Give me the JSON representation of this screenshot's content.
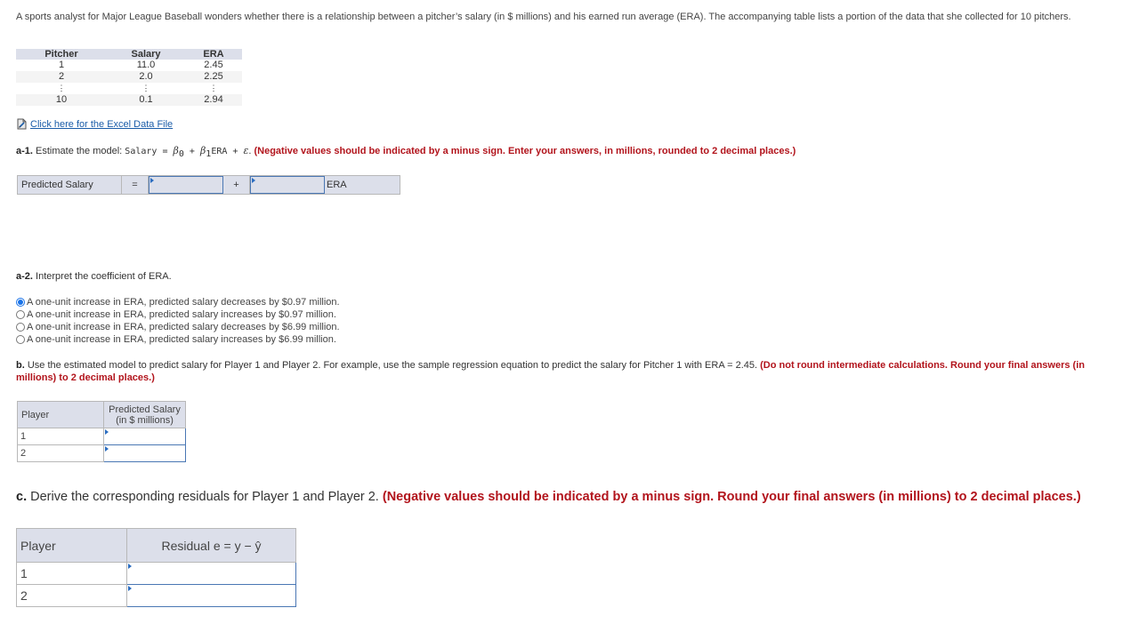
{
  "intro": "A sports analyst for Major League Baseball wonders whether there is a relationship between a pitcher’s salary (in $ millions) and his earned run average (ERA). The accompanying table lists a portion of the data that she collected for 10 pitchers.",
  "data_table": {
    "headers": [
      "Pitcher",
      "Salary",
      "ERA"
    ],
    "rows": [
      [
        "1",
        "11.0",
        "2.45"
      ],
      [
        "2",
        "2.0",
        "2.25"
      ],
      [
        "⋮",
        "⋮",
        "⋮"
      ],
      [
        "10",
        "0.1",
        "2.94"
      ]
    ]
  },
  "excel_link": {
    "icon": "excel-file-icon",
    "label": " Click here for the Excel Data File"
  },
  "a1": {
    "label": "a-1.",
    "text": " Estimate the model: ",
    "model_salary": "Salary",
    "model_eq": " = ",
    "beta0": "β",
    "beta0_sub": "0",
    "plus1": " + ",
    "beta1": "β",
    "beta1_sub": "1",
    "model_era": "ERA",
    "plus2": " + ",
    "epsilon": "ε",
    "period": ". ",
    "instruction": "(Negative values should be indicated by a minus sign. Enter your answers, in millions, rounded to 2 decimal places.)"
  },
  "equation": {
    "label": "Predicted Salary",
    "equals": "=",
    "intercept_value": "",
    "plus": "+",
    "slope_value": "",
    "tail": "ERA"
  },
  "a2": {
    "label": "a-2.",
    "text": " Interpret the coefficient of ERA.",
    "options": [
      {
        "label": "A one-unit increase in ERA, predicted salary decreases by $0.97 million.",
        "selected": true
      },
      {
        "label": "A one-unit increase in ERA, predicted salary increases by $0.97 million.",
        "selected": false
      },
      {
        "label": "A one-unit increase in ERA, predicted salary decreases by $6.99 million.",
        "selected": false
      },
      {
        "label": "A one-unit increase in ERA, predicted salary increases by $6.99 million.",
        "selected": false
      }
    ]
  },
  "b": {
    "label": "b.",
    "text": " Use the estimated model to predict salary for Player 1 and Player 2. For example, use the sample regression equation to predict the salary for Pitcher 1 with ERA = 2.45. ",
    "instruction": "(Do not round intermediate calculations. Round your final answers (in millions) to 2 decimal places.)",
    "table": {
      "col1": "Player",
      "col2_line1": "Predicted Salary",
      "col2_line2": "(in $ millions)",
      "rows": [
        {
          "player": "1",
          "value": ""
        },
        {
          "player": "2",
          "value": ""
        }
      ]
    }
  },
  "c": {
    "label": "c.",
    "text": " Derive the corresponding residuals for Player 1 and Player 2. ",
    "instruction": "(Negative values should be indicated by a minus sign. Round your final answers (in millions) to 2 decimal places.)",
    "table": {
      "col1": "Player",
      "col2": "Residual e = y − ŷ",
      "rows": [
        {
          "player": "1",
          "value": ""
        },
        {
          "player": "2",
          "value": ""
        }
      ]
    }
  },
  "colors": {
    "accent_blue": "#1a5ca8",
    "instruction_red": "#b2141c",
    "header_bg": "#dcdfea",
    "input_border": "#4a77b4"
  }
}
